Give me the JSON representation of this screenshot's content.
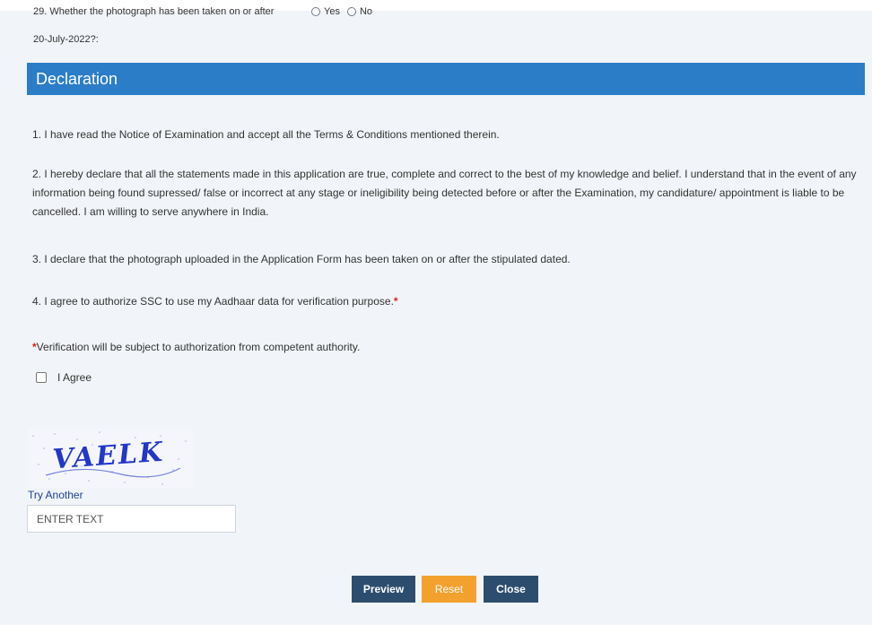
{
  "question29": {
    "text_line1": "29. Whether the photograph has been taken on or after",
    "text_line2": "20-July-2022?:",
    "option_yes": "Yes",
    "option_no": "No"
  },
  "declaration": {
    "title": "Declaration",
    "items": [
      "1. I have read the Notice of Examination and accept all the Terms & Conditions mentioned therein.",
      "2. I hereby declare that all the statements made in this application are true, complete and correct to the best of my knowledge and belief. I understand that in the event of any information being found supressed/ false or incorrect at any stage or ineligibility being detected before or after the Examination, my candidature/ appointment is liable to be cancelled. I am willing to serve anywhere in India.",
      "3. I declare that the photograph uploaded in the Application Form has been taken on or after the stipulated dated.",
      "4. I agree to authorize SSC to use my Aadhaar data for verification purpose."
    ],
    "required_mark": "*",
    "note": "Verification will be subject to authorization from competent authority.",
    "agree_label": "I Agree"
  },
  "captcha": {
    "image_text": "VAELK",
    "try_another": "Try Another",
    "placeholder": "ENTER TEXT"
  },
  "buttons": {
    "preview": "Preview",
    "reset": "Reset",
    "close": "Close"
  },
  "colors": {
    "header_blue": "#2b7dc8",
    "button_dark": "#2d4d6e",
    "button_orange": "#f2a12e",
    "required_red": "#e02020"
  }
}
